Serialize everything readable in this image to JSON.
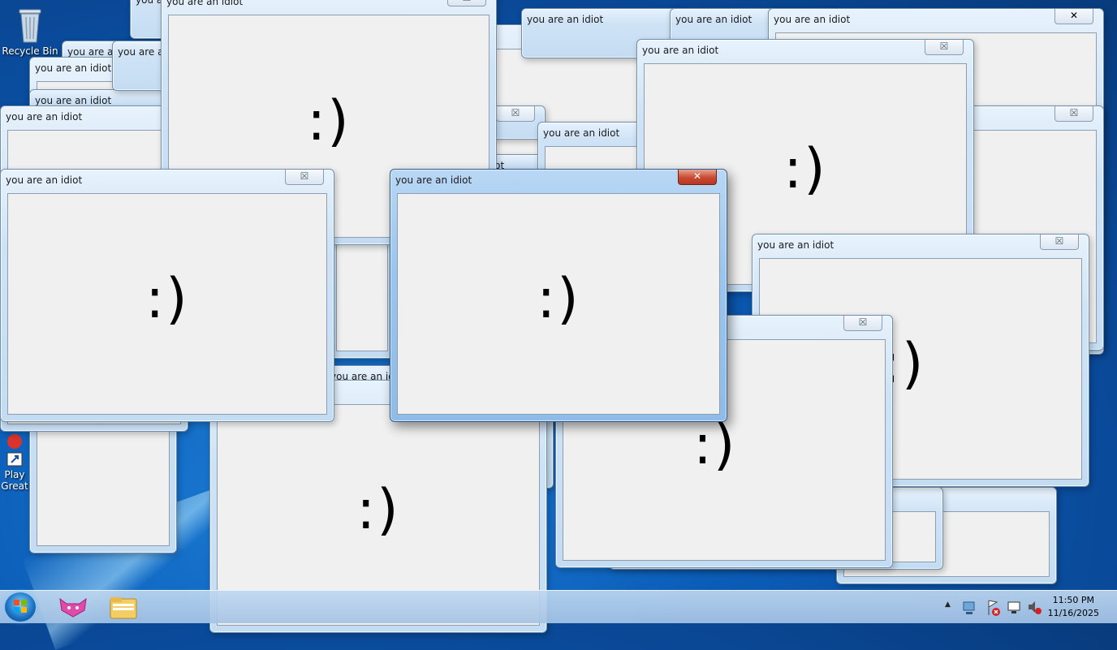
{
  "window_title": "you are an idiot",
  "window_body": ":)",
  "close_glyph": "☒",
  "desktop_icons": {
    "recycle_bin": "Recycle Bin",
    "play_label_1": "Play",
    "play_label_2": "Great"
  },
  "taskbar": {
    "time": "11:50 PM",
    "date": "11/16/2025",
    "tray_expand": "▲"
  }
}
